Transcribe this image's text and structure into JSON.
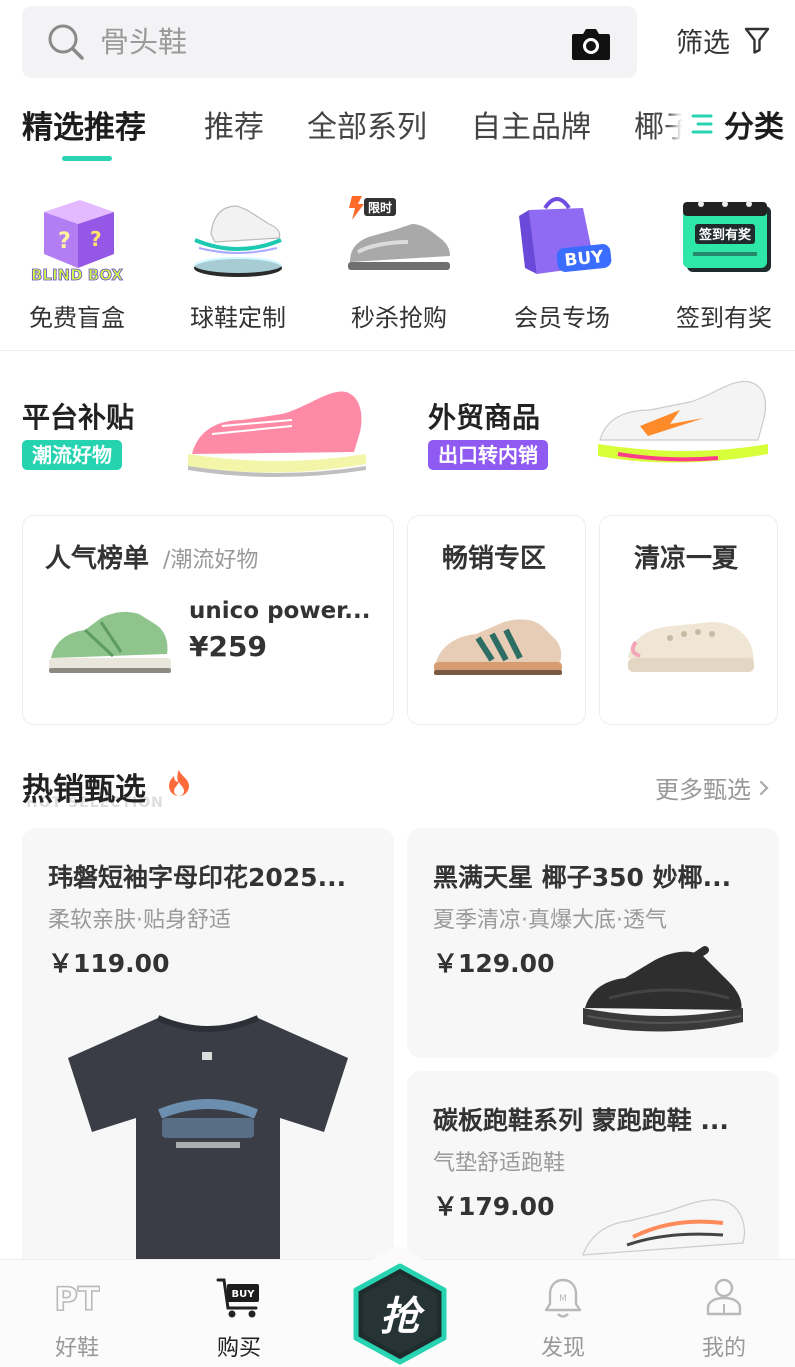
{
  "search": {
    "placeholder": "骨头鞋"
  },
  "filter": {
    "label": "筛选"
  },
  "tabs": [
    {
      "label": "精选推荐"
    },
    {
      "label": "推荐"
    },
    {
      "label": "全部系列"
    },
    {
      "label": "自主品牌"
    },
    {
      "label": "椰子"
    }
  ],
  "category": {
    "label": "分类"
  },
  "quick_entries": [
    {
      "label": "免费盲盒",
      "badge": "BLIND BOX"
    },
    {
      "label": "球鞋定制"
    },
    {
      "label": "秒杀抢购",
      "badge": "限时"
    },
    {
      "label": "会员专场",
      "badge": "BUY"
    },
    {
      "label": "签到有奖",
      "badge": "签到有奖"
    }
  ],
  "promos": [
    {
      "title": "平台补贴",
      "tag": "潮流好物",
      "tag_color": "#26d3b0"
    },
    {
      "title": "外贸商品",
      "tag": "出口转内销",
      "tag_color": "#8f5af2"
    }
  ],
  "ranking": {
    "title": "人气榜单",
    "subtitle": "/潮流好物",
    "product_name": "unico power...",
    "product_price": "¥259"
  },
  "bestseller": {
    "title": "畅销专区"
  },
  "summer": {
    "title": "清凉一夏"
  },
  "hot": {
    "title": "热销甄选",
    "ghost": "HOT SELECTION",
    "more": "更多甄选"
  },
  "products": [
    {
      "name": "玮磐短袖字母印花2025...",
      "desc": "柔软亲肤·贴身舒适",
      "price": "￥119.00"
    },
    {
      "name": "黑满天星 椰子350 妙椰...",
      "desc": "夏季清凉·真爆大底·透气",
      "price": "￥129.00"
    },
    {
      "name": "碳板跑鞋系列 蒙跑跑鞋 ...",
      "desc": "气垫舒适跑鞋",
      "price": "￥179.00"
    }
  ],
  "nav": [
    {
      "label": "好鞋",
      "icon": "pt-icon"
    },
    {
      "label": "购买",
      "icon": "cart-icon"
    },
    {
      "label": "抢",
      "icon": "grab-icon"
    },
    {
      "label": "发现",
      "icon": "bell-icon"
    },
    {
      "label": "我的",
      "icon": "profile-icon"
    }
  ],
  "colors": {
    "accent": "#2ad4b3",
    "grab_bg": "#1f2b2d",
    "grab_border": "#27d3b1"
  }
}
